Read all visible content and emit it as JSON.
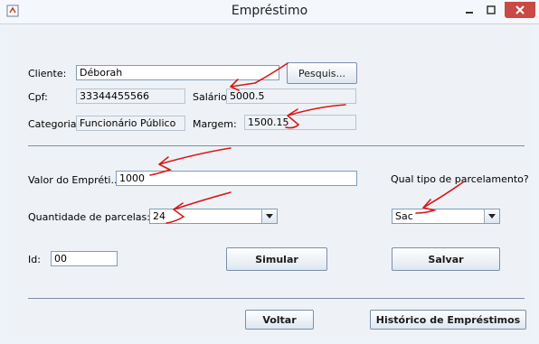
{
  "window": {
    "title": "Empréstimo"
  },
  "client": {
    "cliente_label": "Cliente:",
    "cliente_value": "Déborah",
    "search_button": "Pesquis...",
    "cpf_label": "Cpf:",
    "cpf_value": "33344455566",
    "salario_label": "Salário:",
    "salario_value": "5000.5",
    "categoria_label": "Categoria:",
    "categoria_value": "Funcionário Público",
    "margem_label": "Margem:",
    "margem_value": "1500.15"
  },
  "loan": {
    "valor_label": "Valor do Empréti...",
    "valor_value": "1000",
    "parcelamento_label": "Qual tipo de parcelamento?",
    "parcelas_label": "Quantidade de parcelas:",
    "parcelas_selected": "24",
    "parcelamento_selected": "Sac",
    "id_label": "Id:",
    "id_value": "00",
    "simular_button": "Simular",
    "salvar_button": "Salvar"
  },
  "footer": {
    "voltar_button": "Voltar",
    "historico_button": "Histórico de Empréstimos"
  },
  "colors": {
    "annotation": "#d81818"
  }
}
